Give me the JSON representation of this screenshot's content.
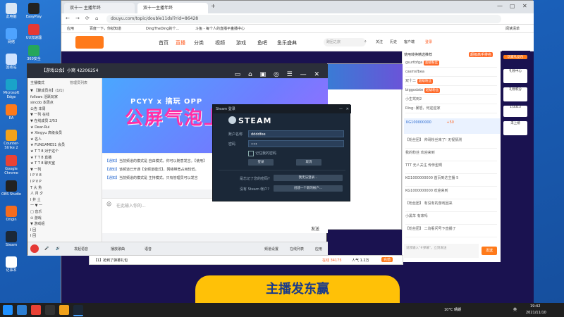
{
  "desktop": {
    "icons": [
      {
        "label": "此电脑",
        "color": "#d9e6f5"
      },
      {
        "label": "网络",
        "color": "#4ea3ff"
      },
      {
        "label": "回收站",
        "color": "#cfe3ff"
      },
      {
        "label": "Microsoft Edge",
        "color": "#1aa3c9"
      },
      {
        "label": "EA",
        "color": "#ff7a1a"
      },
      {
        "label": "Counter-Strike 2",
        "color": "#f1a21b"
      },
      {
        "label": "Google Chrome",
        "color": "#e94235"
      },
      {
        "label": "OBS Studio",
        "color": "#222"
      },
      {
        "label": "Origin",
        "color": "#f56c1f"
      },
      {
        "label": "Steam",
        "color": "#1b2838"
      },
      {
        "label": "记事本",
        "color": "#fff"
      }
    ],
    "col2_icons": [
      {
        "label": "EasyPlay",
        "color": "#222"
      },
      {
        "label": "UU加速器",
        "color": "#e53935"
      },
      {
        "label": "360安全",
        "color": "#26a65b"
      },
      {
        "label": "聊天",
        "color": "#ffffff"
      }
    ]
  },
  "browser": {
    "tabs": [
      {
        "label": "双十一 主播年终",
        "active": false
      },
      {
        "label": "双十一主播年终",
        "active": true
      }
    ],
    "address": "douyu.com/topic/double11dsl?rid=86428",
    "bookmarks": [
      "应用",
      "百度一下，你就知道",
      "DingTheDing的个...",
      "斗鱼 - 每个人的直播平台",
      "主播中心"
    ],
    "reading_mode": "阅读清单"
  },
  "douyu": {
    "nav": [
      {
        "label": "首页",
        "active": false
      },
      {
        "label": "直播",
        "active": true
      },
      {
        "label": "分类",
        "active": false
      },
      {
        "label": "视频",
        "active": false
      },
      {
        "label": "游戏",
        "active": false
      },
      {
        "label": "鱼吧",
        "active": false
      },
      {
        "label": "鱼乐盛典",
        "active": false
      }
    ],
    "search_placeholder": "跑团之旅",
    "header_actions": [
      "关注",
      "历史",
      "客户端",
      "登录"
    ],
    "bottom_cta": "主播发东赢",
    "page_bar_items": [
      "【1】抢到了弹幕礼包",
      "在线 34175",
      "人气 1.2万",
      "充值"
    ]
  },
  "app": {
    "title": "【游戏公会】小窝 42206254",
    "list_header_left": "主播模式",
    "list_header_right": "管理员列表",
    "list_rows": [
      "▼ 【聚成员点】(1/1)",
      "  follows 活跃玩家",
      "  sincdo 本周点",
      "  公告 本周",
      "▼ 一列 在线",
      "▼ 在线成员 2/53",
      "  ★ Dear-Rui",
      "  ★ Xingyu 高级会员",
      "  ★ 名人",
      "  ★ FUNGAMES1 会员",
      "  ★ T T 8 对于这个",
      "  ★ T T 8 直播",
      "  ★ T T 8 聊天室",
      "  ▼ 一列",
      "  I P V 8",
      "  I P V P",
      "  T 大 魚",
      "  人 月 夕",
      "  I 井 土",
      "  一 ▼ 一",
      "  □ 音乐",
      "  ⊙ 游戏",
      "  ▼ 游戏组",
      "  I 回",
      "  I 回"
    ],
    "banner_small": "PCYY x 搞玩 OPP",
    "banner_big": "公屏气泡上线啦!",
    "notices": [
      {
        "tag": "【通知】",
        "text": "当前频道的模式是 自由模式，你可以随意发言。【使用】"
      },
      {
        "tag": "【通知】",
        "text": "该频道已开通【全频道模式】，网络带宽占用较低。"
      },
      {
        "tag": "【通知】",
        "text": "当前频道的模式是 主持模式，只有管理员可以发言"
      }
    ],
    "input_placeholder": "在此输入你的...",
    "send_label": "发送",
    "footer_items": [
      "我的",
      "频道",
      "直播",
      "语音",
      "团队",
      "发起语音",
      "播放歌曲",
      "语音"
    ],
    "footer_right": [
      "频道设置",
      "在线列表",
      "应用"
    ]
  },
  "right_chat": {
    "header": "使用转换精选推荐",
    "top_badge": "超级高手排名",
    "rows": [
      {
        "user": "gsurtbfga",
        "badge": "超级粉丝"
      },
      {
        "user": "casmsfbea",
        "badge": ""
      },
      {
        "user": "双十二",
        "badge": "超级粉丝"
      },
      {
        "user": "biggodate",
        "badge": "超级粉丝"
      },
      {
        "user": "小生驾到2",
        "badge": ""
      },
      {
        "user": "Ring: 暴怒，何迎迎家",
        "badge": ""
      }
    ],
    "rank_label": "KG100000000",
    "gift_text": "+50",
    "messages": [
      "【粉丝团】 帅哥粉丝来了! 无视猜测",
      "我的粉丝 欢迎来到",
      "TTT 无人关注 传传型啊",
      "KG1000000000 首页到达主播 5",
      "KG1000000000 欢迎来到",
      "【粉丝团】 有没有的游戏回来",
      "小黑羊 有来吗",
      "【粉丝团】 二询看问号下直播了"
    ],
    "input_placeholder": "说我输入\"#弹幕\"，立刻发送",
    "send": "发送"
  },
  "right_side": {
    "top": "玩家礼品包",
    "items": [
      "礼物中心",
      "礼物积分",
      "未上榜",
      "1/3313"
    ]
  },
  "steam": {
    "window_title": "Steam 登录",
    "logo": "STEAM",
    "account_label": "账户名称",
    "account_value": "ddddfee",
    "password_label": "密码",
    "password_value": "•••",
    "remember_label": "记住我的密码",
    "login_btn": "登录",
    "cancel_btn": "取消",
    "forgot_label": "是忘记了您的密码?",
    "forgot_btn": "我无法登录...",
    "no_account_label": "没有 Steam 帐户?",
    "create_btn": "创建一个新的帐户..."
  },
  "taskbar": {
    "weather": "10°C 晴朗",
    "ime": "英",
    "time": "19:42",
    "date": "2021/11/10"
  }
}
